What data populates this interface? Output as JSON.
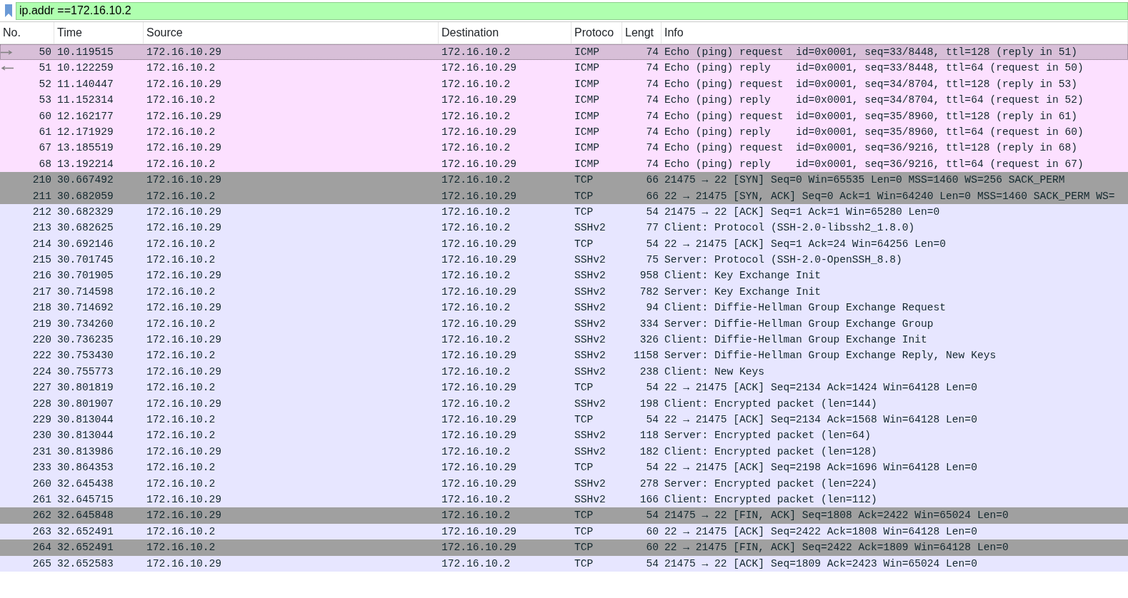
{
  "filter": {
    "value": "ip.addr ==172.16.10.2"
  },
  "columns": [
    "No.",
    "Time",
    "Source",
    "Destination",
    "Protoco",
    "Lengt",
    "Info"
  ],
  "rows": [
    {
      "no": "50",
      "time": "10.119515",
      "source": "172.16.10.29",
      "destination": "172.16.10.2",
      "protocol": "ICMP",
      "length": "74",
      "info": "Echo (ping) request  id=0x0001, seq=33/8448, ttl=128 (reply in 51)",
      "color": "#d8bfd8",
      "selected": true,
      "related_request": true
    },
    {
      "no": "51",
      "time": "10.122259",
      "source": "172.16.10.2",
      "destination": "172.16.10.29",
      "protocol": "ICMP",
      "length": "74",
      "info": "Echo (ping) reply    id=0x0001, seq=33/8448, ttl=64 (request in 50)",
      "color": "#fce0ff",
      "selected": false,
      "related_reply": true
    },
    {
      "no": "52",
      "time": "11.140447",
      "source": "172.16.10.29",
      "destination": "172.16.10.2",
      "protocol": "ICMP",
      "length": "74",
      "info": "Echo (ping) request  id=0x0001, seq=34/8704, ttl=128 (reply in 53)",
      "color": "#fce0ff",
      "selected": false
    },
    {
      "no": "53",
      "time": "11.152314",
      "source": "172.16.10.2",
      "destination": "172.16.10.29",
      "protocol": "ICMP",
      "length": "74",
      "info": "Echo (ping) reply    id=0x0001, seq=34/8704, ttl=64 (request in 52)",
      "color": "#fce0ff",
      "selected": false
    },
    {
      "no": "60",
      "time": "12.162177",
      "source": "172.16.10.29",
      "destination": "172.16.10.2",
      "protocol": "ICMP",
      "length": "74",
      "info": "Echo (ping) request  id=0x0001, seq=35/8960, ttl=128 (reply in 61)",
      "color": "#fce0ff",
      "selected": false
    },
    {
      "no": "61",
      "time": "12.171929",
      "source": "172.16.10.2",
      "destination": "172.16.10.29",
      "protocol": "ICMP",
      "length": "74",
      "info": "Echo (ping) reply    id=0x0001, seq=35/8960, ttl=64 (request in 60)",
      "color": "#fce0ff",
      "selected": false
    },
    {
      "no": "67",
      "time": "13.185519",
      "source": "172.16.10.29",
      "destination": "172.16.10.2",
      "protocol": "ICMP",
      "length": "74",
      "info": "Echo (ping) request  id=0x0001, seq=36/9216, ttl=128 (reply in 68)",
      "color": "#fce0ff",
      "selected": false
    },
    {
      "no": "68",
      "time": "13.192214",
      "source": "172.16.10.2",
      "destination": "172.16.10.29",
      "protocol": "ICMP",
      "length": "74",
      "info": "Echo (ping) reply    id=0x0001, seq=36/9216, ttl=64 (request in 67)",
      "color": "#fce0ff",
      "selected": false
    },
    {
      "no": "210",
      "time": "30.667492",
      "source": "172.16.10.29",
      "destination": "172.16.10.2",
      "protocol": "TCP",
      "length": "66",
      "info": "21475 → 22 [SYN] Seq=0 Win=65535 Len=0 MSS=1460 WS=256 SACK_PERM",
      "color": "#a0a0a0",
      "selected": false
    },
    {
      "no": "211",
      "time": "30.682059",
      "source": "172.16.10.2",
      "destination": "172.16.10.29",
      "protocol": "TCP",
      "length": "66",
      "info": "22 → 21475 [SYN, ACK] Seq=0 Ack=1 Win=64240 Len=0 MSS=1460 SACK_PERM WS=",
      "color": "#a0a0a0",
      "selected": false
    },
    {
      "no": "212",
      "time": "30.682329",
      "source": "172.16.10.29",
      "destination": "172.16.10.2",
      "protocol": "TCP",
      "length": "54",
      "info": "21475 → 22 [ACK] Seq=1 Ack=1 Win=65280 Len=0",
      "color": "#e7e6ff",
      "selected": false
    },
    {
      "no": "213",
      "time": "30.682625",
      "source": "172.16.10.29",
      "destination": "172.16.10.2",
      "protocol": "SSHv2",
      "length": "77",
      "info": "Client: Protocol (SSH-2.0-libssh2_1.8.0)",
      "color": "#e7e6ff",
      "selected": false
    },
    {
      "no": "214",
      "time": "30.692146",
      "source": "172.16.10.2",
      "destination": "172.16.10.29",
      "protocol": "TCP",
      "length": "54",
      "info": "22 → 21475 [ACK] Seq=1 Ack=24 Win=64256 Len=0",
      "color": "#e7e6ff",
      "selected": false
    },
    {
      "no": "215",
      "time": "30.701745",
      "source": "172.16.10.2",
      "destination": "172.16.10.29",
      "protocol": "SSHv2",
      "length": "75",
      "info": "Server: Protocol (SSH-2.0-OpenSSH_8.8)",
      "color": "#e7e6ff",
      "selected": false
    },
    {
      "no": "216",
      "time": "30.701905",
      "source": "172.16.10.29",
      "destination": "172.16.10.2",
      "protocol": "SSHv2",
      "length": "958",
      "info": "Client: Key Exchange Init",
      "color": "#e7e6ff",
      "selected": false
    },
    {
      "no": "217",
      "time": "30.714598",
      "source": "172.16.10.2",
      "destination": "172.16.10.29",
      "protocol": "SSHv2",
      "length": "782",
      "info": "Server: Key Exchange Init",
      "color": "#e7e6ff",
      "selected": false
    },
    {
      "no": "218",
      "time": "30.714692",
      "source": "172.16.10.29",
      "destination": "172.16.10.2",
      "protocol": "SSHv2",
      "length": "94",
      "info": "Client: Diffie-Hellman Group Exchange Request",
      "color": "#e7e6ff",
      "selected": false
    },
    {
      "no": "219",
      "time": "30.734260",
      "source": "172.16.10.2",
      "destination": "172.16.10.29",
      "protocol": "SSHv2",
      "length": "334",
      "info": "Server: Diffie-Hellman Group Exchange Group",
      "color": "#e7e6ff",
      "selected": false
    },
    {
      "no": "220",
      "time": "30.736235",
      "source": "172.16.10.29",
      "destination": "172.16.10.2",
      "protocol": "SSHv2",
      "length": "326",
      "info": "Client: Diffie-Hellman Group Exchange Init",
      "color": "#e7e6ff",
      "selected": false
    },
    {
      "no": "222",
      "time": "30.753430",
      "source": "172.16.10.2",
      "destination": "172.16.10.29",
      "protocol": "SSHv2",
      "length": "1158",
      "info": "Server: Diffie-Hellman Group Exchange Reply, New Keys",
      "color": "#e7e6ff",
      "selected": false
    },
    {
      "no": "224",
      "time": "30.755773",
      "source": "172.16.10.29",
      "destination": "172.16.10.2",
      "protocol": "SSHv2",
      "length": "238",
      "info": "Client: New Keys",
      "color": "#e7e6ff",
      "selected": false
    },
    {
      "no": "227",
      "time": "30.801819",
      "source": "172.16.10.2",
      "destination": "172.16.10.29",
      "protocol": "TCP",
      "length": "54",
      "info": "22 → 21475 [ACK] Seq=2134 Ack=1424 Win=64128 Len=0",
      "color": "#e7e6ff",
      "selected": false
    },
    {
      "no": "228",
      "time": "30.801907",
      "source": "172.16.10.29",
      "destination": "172.16.10.2",
      "protocol": "SSHv2",
      "length": "198",
      "info": "Client: Encrypted packet (len=144)",
      "color": "#e7e6ff",
      "selected": false
    },
    {
      "no": "229",
      "time": "30.813044",
      "source": "172.16.10.2",
      "destination": "172.16.10.29",
      "protocol": "TCP",
      "length": "54",
      "info": "22 → 21475 [ACK] Seq=2134 Ack=1568 Win=64128 Len=0",
      "color": "#e7e6ff",
      "selected": false
    },
    {
      "no": "230",
      "time": "30.813044",
      "source": "172.16.10.2",
      "destination": "172.16.10.29",
      "protocol": "SSHv2",
      "length": "118",
      "info": "Server: Encrypted packet (len=64)",
      "color": "#e7e6ff",
      "selected": false
    },
    {
      "no": "231",
      "time": "30.813986",
      "source": "172.16.10.29",
      "destination": "172.16.10.2",
      "protocol": "SSHv2",
      "length": "182",
      "info": "Client: Encrypted packet (len=128)",
      "color": "#e7e6ff",
      "selected": false
    },
    {
      "no": "233",
      "time": "30.864353",
      "source": "172.16.10.2",
      "destination": "172.16.10.29",
      "protocol": "TCP",
      "length": "54",
      "info": "22 → 21475 [ACK] Seq=2198 Ack=1696 Win=64128 Len=0",
      "color": "#e7e6ff",
      "selected": false
    },
    {
      "no": "260",
      "time": "32.645438",
      "source": "172.16.10.2",
      "destination": "172.16.10.29",
      "protocol": "SSHv2",
      "length": "278",
      "info": "Server: Encrypted packet (len=224)",
      "color": "#e7e6ff",
      "selected": false
    },
    {
      "no": "261",
      "time": "32.645715",
      "source": "172.16.10.29",
      "destination": "172.16.10.2",
      "protocol": "SSHv2",
      "length": "166",
      "info": "Client: Encrypted packet (len=112)",
      "color": "#e7e6ff",
      "selected": false
    },
    {
      "no": "262",
      "time": "32.645848",
      "source": "172.16.10.29",
      "destination": "172.16.10.2",
      "protocol": "TCP",
      "length": "54",
      "info": "21475 → 22 [FIN, ACK] Seq=1808 Ack=2422 Win=65024 Len=0",
      "color": "#a0a0a0",
      "selected": false
    },
    {
      "no": "263",
      "time": "32.652491",
      "source": "172.16.10.2",
      "destination": "172.16.10.29",
      "protocol": "TCP",
      "length": "60",
      "info": "22 → 21475 [ACK] Seq=2422 Ack=1808 Win=64128 Len=0",
      "color": "#e7e6ff",
      "selected": false
    },
    {
      "no": "264",
      "time": "32.652491",
      "source": "172.16.10.2",
      "destination": "172.16.10.29",
      "protocol": "TCP",
      "length": "60",
      "info": "22 → 21475 [FIN, ACK] Seq=2422 Ack=1809 Win=64128 Len=0",
      "color": "#a0a0a0",
      "selected": false
    },
    {
      "no": "265",
      "time": "32.652583",
      "source": "172.16.10.29",
      "destination": "172.16.10.2",
      "protocol": "TCP",
      "length": "54",
      "info": "21475 → 22 [ACK] Seq=1809 Ack=2423 Win=65024 Len=0",
      "color": "#e7e6ff",
      "selected": false
    }
  ]
}
